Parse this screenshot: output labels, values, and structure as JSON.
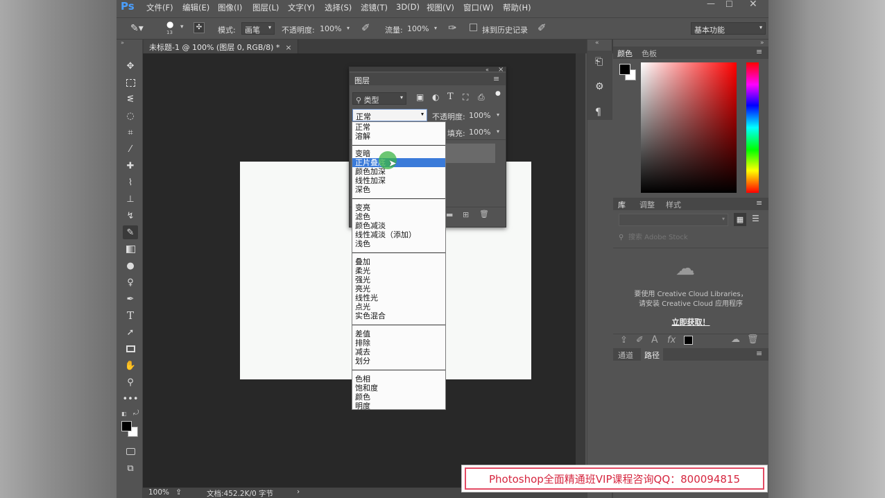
{
  "menubar": {
    "logo": "Ps",
    "items": [
      "文件(F)",
      "编辑(E)",
      "图像(I)",
      "图层(L)",
      "文字(Y)",
      "选择(S)",
      "滤镜(T)",
      "3D(D)",
      "视图(V)",
      "窗口(W)",
      "帮助(H)"
    ]
  },
  "options": {
    "brush_size": "13",
    "mode_label": "模式:",
    "mode_value": "画笔",
    "opacity_label": "不透明度:",
    "opacity_value": "100%",
    "flow_label": "流量:",
    "flow_value": "100%",
    "erase_history_label": "抹到历史记录",
    "workspace": "基本功能"
  },
  "document": {
    "tab_title": "未标题-1 @ 100% (图层 0, RGB/8) *",
    "zoom": "100%",
    "doc_info": "文档:452.2K/0 字节"
  },
  "layers_panel": {
    "title": "图层",
    "filter_label": "类型",
    "blend_mode": "正常",
    "opacity_label": "不透明度:",
    "opacity_value": "100%",
    "fill_label": "填充:",
    "fill_value": "100%"
  },
  "blend_modes": {
    "groups": [
      [
        "正常",
        "溶解"
      ],
      [
        "变暗",
        "正片叠底",
        "颜色加深",
        "线性加深",
        "深色"
      ],
      [
        "变亮",
        "滤色",
        "颜色减淡",
        "线性减淡（添加）",
        "浅色"
      ],
      [
        "叠加",
        "柔光",
        "强光",
        "亮光",
        "线性光",
        "点光",
        "实色混合"
      ],
      [
        "差值",
        "排除",
        "减去",
        "划分"
      ],
      [
        "色相",
        "饱和度",
        "颜色",
        "明度"
      ]
    ],
    "highlighted": "正片叠底"
  },
  "color_panel": {
    "tabs": [
      "颜色",
      "色板"
    ],
    "foreground": "#000000",
    "background": "#ffffff",
    "hue": "#ff0000"
  },
  "library_panel": {
    "tabs": [
      "库",
      "调整",
      "样式"
    ],
    "search_placeholder": "搜索 Adobe Stock",
    "message_line1": "要使用 Creative Cloud Libraries，",
    "message_line2": "请安装 Creative Cloud 应用程序",
    "cta": "立即获取！"
  },
  "paths_panel": {
    "tabs": [
      "通道",
      "路径"
    ]
  },
  "banner": {
    "text": "Photoshop全面精通班VIP课程咨询QQ：800094815"
  }
}
